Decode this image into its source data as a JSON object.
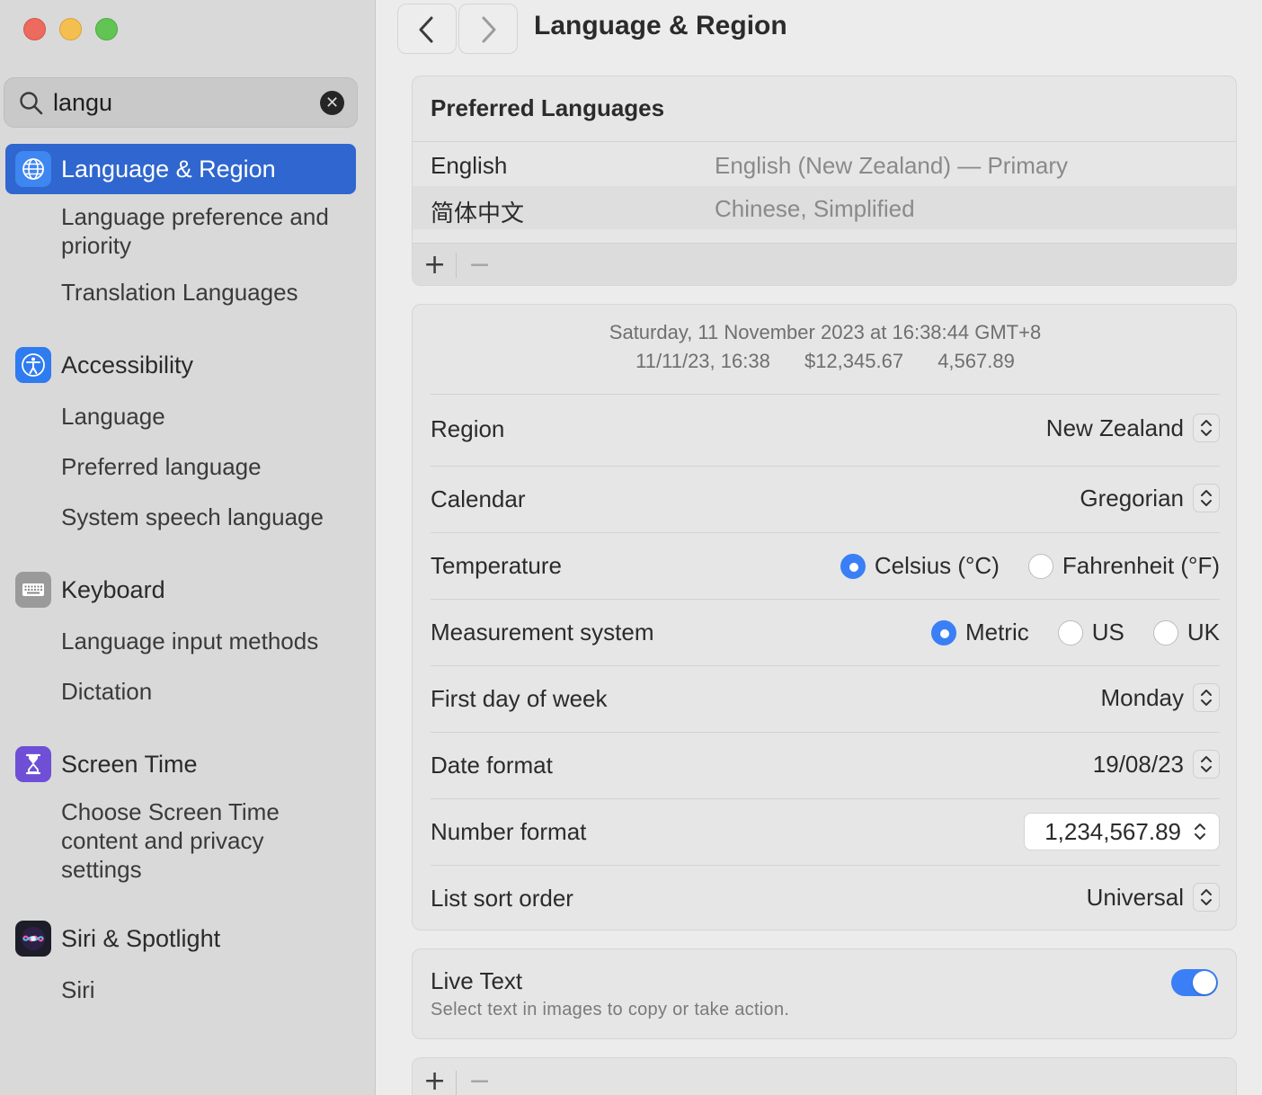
{
  "window": {
    "title": "Language & Region"
  },
  "search": {
    "value": "langu"
  },
  "sidebar": {
    "groups": [
      {
        "label": "Language & Region",
        "icon": "globe-icon",
        "selected": true,
        "items": [
          "Language preference and priority",
          "Translation Languages"
        ]
      },
      {
        "label": "Accessibility",
        "icon": "accessibility-icon",
        "items": [
          "Language",
          "Preferred language",
          "System speech language"
        ]
      },
      {
        "label": "Keyboard",
        "icon": "keyboard-icon",
        "items": [
          "Language input methods",
          "Dictation"
        ]
      },
      {
        "label": "Screen Time",
        "icon": "hourglass-icon",
        "items": [
          "Choose Screen Time content and privacy settings"
        ]
      },
      {
        "label": "Siri & Spotlight",
        "icon": "siri-icon",
        "items": [
          "Siri"
        ]
      }
    ]
  },
  "preferred_languages": {
    "title": "Preferred Languages",
    "rows": [
      {
        "name": "English",
        "detail": "English (New Zealand) — Primary"
      },
      {
        "name": "简体中文",
        "detail": "Chinese, Simplified"
      }
    ],
    "add_label": "+",
    "remove_label": "−"
  },
  "format_preview": {
    "line1": "Saturday, 11 November 2023 at 16:38:44 GMT+8",
    "date": "11/11/23, 16:38",
    "currency": "$12,345.67",
    "number": "4,567.89"
  },
  "settings": {
    "region": {
      "label": "Region",
      "value": "New Zealand"
    },
    "calendar": {
      "label": "Calendar",
      "value": "Gregorian"
    },
    "temperature": {
      "label": "Temperature",
      "options": [
        "Celsius (°C)",
        "Fahrenheit (°F)"
      ],
      "selected": "Celsius (°C)"
    },
    "measurement": {
      "label": "Measurement system",
      "options": [
        "Metric",
        "US",
        "UK"
      ],
      "selected": "Metric"
    },
    "first_day": {
      "label": "First day of week",
      "value": "Monday"
    },
    "date_format": {
      "label": "Date format",
      "value": "19/08/23"
    },
    "number_format": {
      "label": "Number format",
      "value": "1,234,567.89"
    },
    "sort_order": {
      "label": "List sort order",
      "value": "Universal"
    }
  },
  "live_text": {
    "title": "Live Text",
    "description": "Select text in images to copy or take action.",
    "enabled": true
  },
  "bottom_bar": {
    "add_label": "+",
    "remove_label": "−"
  },
  "colors": {
    "accent": "#3a7ff5",
    "selection": "#2f66cf"
  }
}
